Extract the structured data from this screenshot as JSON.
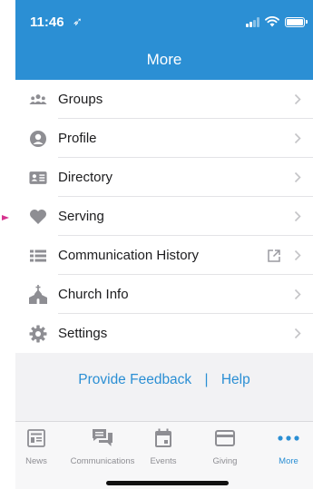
{
  "status_bar": {
    "time": "11:46",
    "location_glyph": "➶"
  },
  "header": {
    "title": "More",
    "color": "#2b8fd4"
  },
  "menu": {
    "items": [
      {
        "label": "Groups",
        "icon": "groups-icon"
      },
      {
        "label": "Profile",
        "icon": "profile-icon"
      },
      {
        "label": "Directory",
        "icon": "directory-icon"
      },
      {
        "label": "Serving",
        "icon": "heart-icon"
      },
      {
        "label": "Communication History",
        "icon": "list-icon",
        "external": true
      },
      {
        "label": "Church Info",
        "icon": "church-icon"
      },
      {
        "label": "Settings",
        "icon": "gear-icon"
      }
    ]
  },
  "links": {
    "feedback": "Provide Feedback",
    "separator": "|",
    "help": "Help"
  },
  "tabbar": {
    "tabs": [
      {
        "label": "News",
        "icon": "news-icon"
      },
      {
        "label": "Communications",
        "icon": "chat-icon"
      },
      {
        "label": "Events",
        "icon": "calendar-icon"
      },
      {
        "label": "Giving",
        "icon": "card-icon"
      },
      {
        "label": "More",
        "icon": "more-dots-icon",
        "active": true
      }
    ],
    "active_color": "#2b8fd4",
    "inactive_color": "#8e8e93"
  },
  "accent_arrow_color": "#d6338f"
}
